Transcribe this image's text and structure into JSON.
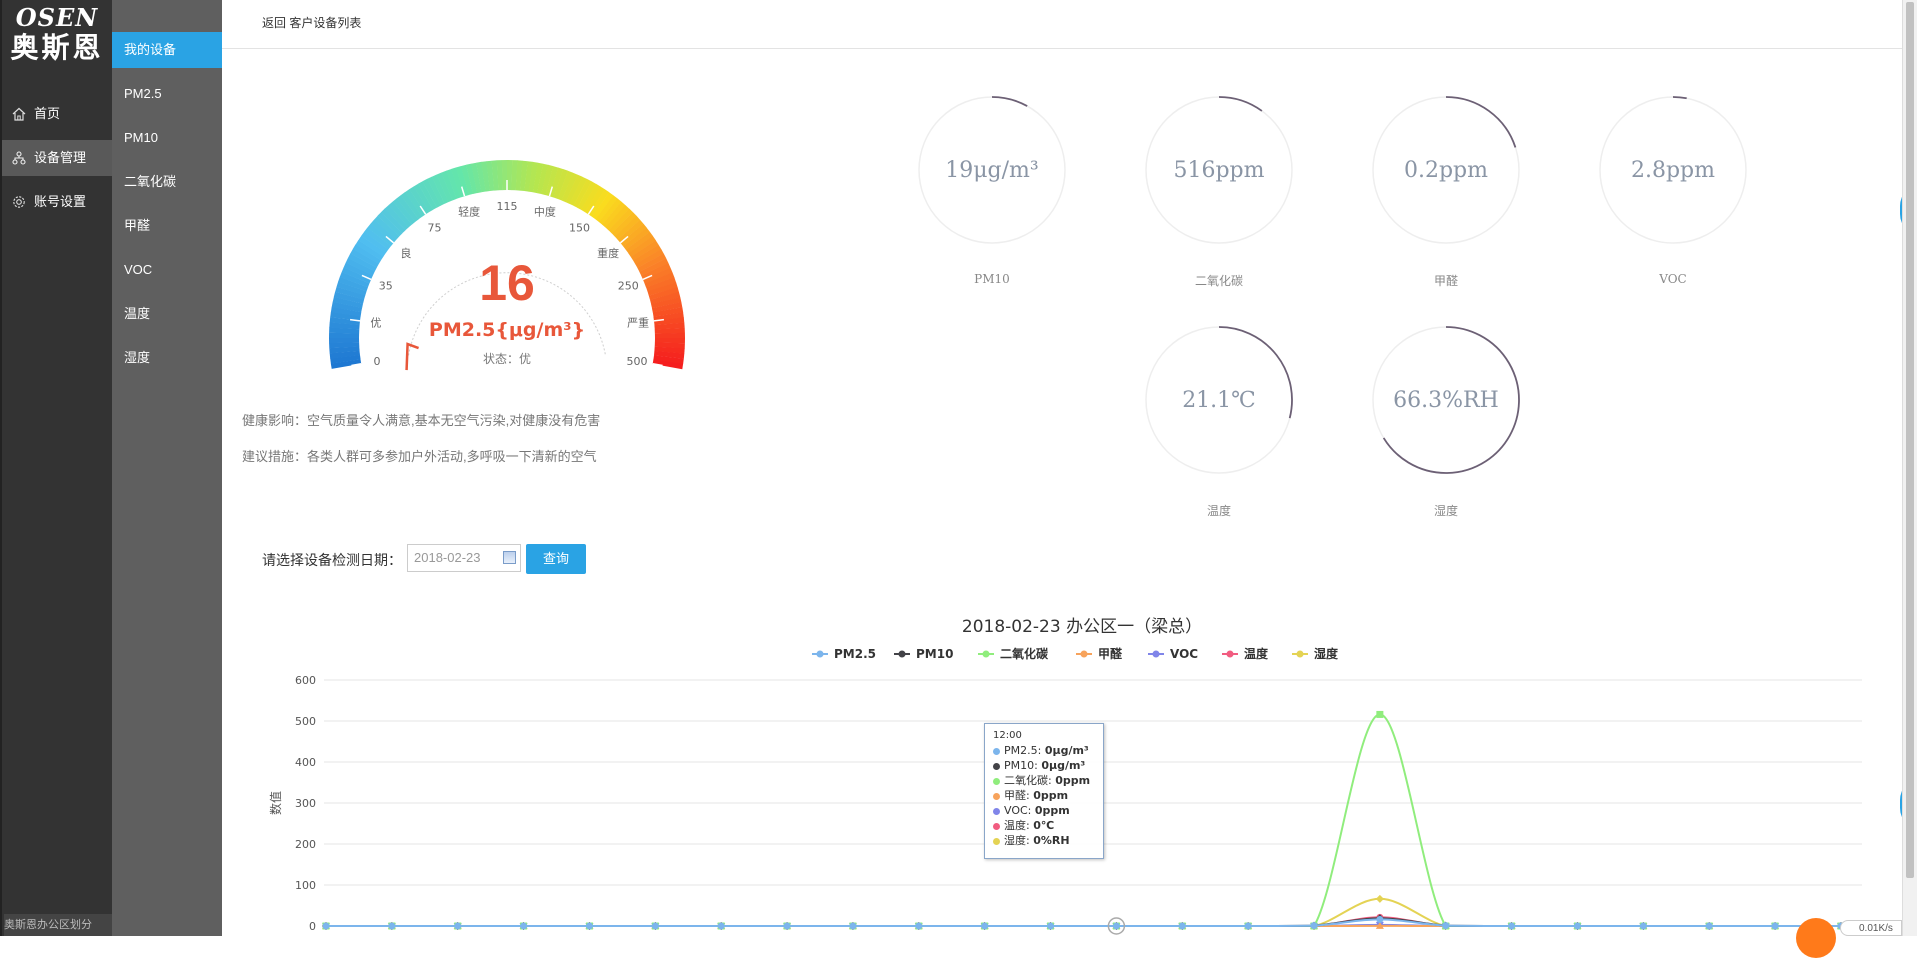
{
  "brand": {
    "en": "OSEN",
    "cn": "奥斯恩"
  },
  "nav": [
    {
      "label": "首页",
      "icon": "home-icon",
      "active": false
    },
    {
      "label": "设备管理",
      "icon": "device-tree-icon",
      "active": true
    },
    {
      "label": "账号设置",
      "icon": "gear-icon",
      "active": false
    }
  ],
  "subnav": [
    "我的设备",
    "PM2.5",
    "PM10",
    "二氧化碳",
    "甲醛",
    "VOC",
    "温度",
    "湿度"
  ],
  "bottom_text": "奥斯恩办公区划分",
  "breadcrumb": {
    "back": "返回",
    "current": "客户设备列表"
  },
  "gauge": {
    "value": "16",
    "unit": "PM2.5{μg/m³}",
    "status": "状态：优",
    "value_num": 16,
    "max": 500,
    "ticks": [
      "0",
      "35",
      "75",
      "115",
      "150",
      "250",
      "500"
    ],
    "levels": [
      "优",
      "良",
      "轻度",
      "中度",
      "重度",
      "严重"
    ],
    "accent_color": "#e8573a"
  },
  "health": {
    "impact": "健康影响：空气质量令人满意,基本无空气污染,对健康没有危害",
    "advice": "建议措施：各类人群可多参加户外活动,多呼吸一下清新的空气"
  },
  "rings": [
    {
      "value": "19μg/m³",
      "label": "PM10",
      "fraction": 0.08
    },
    {
      "value": "516ppm",
      "label": "二氧化碳",
      "fraction": 0.1
    },
    {
      "value": "0.2ppm",
      "label": "甲醛",
      "fraction": 0.2
    },
    {
      "value": "2.8ppm",
      "label": "VOC",
      "fraction": 0.03
    },
    {
      "value": "21.1℃",
      "label": "温度",
      "fraction": 0.29
    },
    {
      "value": "66.3%RH",
      "label": "湿度",
      "fraction": 0.663
    }
  ],
  "date_query": {
    "label": "请选择设备检测日期：",
    "date": "2018-02-23",
    "button": "查询"
  },
  "chart_data": {
    "type": "line",
    "title": "2018-02-23 办公区一（梁总）",
    "ylabel": "数值",
    "ylim": [
      0,
      600
    ],
    "yticks": [
      "0",
      "100",
      "200",
      "300",
      "400",
      "500",
      "600"
    ],
    "grid": true,
    "legend_position": "top-center",
    "x_count": 24,
    "series": [
      {
        "name": "PM2.5",
        "color": "#7cb5ec",
        "marker": "circle",
        "values": [
          0,
          0,
          0,
          0,
          0,
          0,
          0,
          0,
          0,
          0,
          0,
          0,
          0,
          0,
          0,
          1,
          16,
          1,
          0,
          0,
          0,
          0,
          0,
          0
        ]
      },
      {
        "name": "PM10",
        "color": "#434348",
        "marker": "diamond",
        "values": [
          0,
          0,
          0,
          0,
          0,
          0,
          0,
          0,
          0,
          0,
          0,
          0,
          0,
          0,
          0,
          1,
          19,
          1,
          0,
          0,
          0,
          0,
          0,
          0
        ]
      },
      {
        "name": "二氧化碳",
        "color": "#90ed7d",
        "marker": "square",
        "values": [
          0,
          0,
          0,
          0,
          0,
          0,
          0,
          0,
          0,
          0,
          0,
          0,
          0,
          0,
          0,
          0,
          516,
          0,
          0,
          0,
          0,
          0,
          0,
          0
        ]
      },
      {
        "name": "甲醛",
        "color": "#f7a35c",
        "marker": "triangle",
        "values": [
          0,
          0,
          0,
          0,
          0,
          0,
          0,
          0,
          0,
          0,
          0,
          0,
          0,
          0,
          0,
          0,
          0.2,
          0,
          0,
          0,
          0,
          0,
          0,
          0
        ]
      },
      {
        "name": "VOC",
        "color": "#8085e9",
        "marker": "triangle-down",
        "values": [
          0,
          0,
          0,
          0,
          0,
          0,
          0,
          0,
          0,
          0,
          0,
          0,
          0,
          0,
          0,
          0,
          2.8,
          0,
          0,
          0,
          0,
          0,
          0,
          0
        ]
      },
      {
        "name": "温度",
        "color": "#f15c80",
        "marker": "circle",
        "values": [
          0,
          0,
          0,
          0,
          0,
          0,
          0,
          0,
          0,
          0,
          0,
          0,
          0,
          0,
          0,
          0,
          21.1,
          0,
          0,
          0,
          0,
          0,
          0,
          0
        ]
      },
      {
        "name": "湿度",
        "color": "#e4d354",
        "marker": "diamond",
        "values": [
          0,
          0,
          0,
          0,
          0,
          0,
          0,
          0,
          0,
          0,
          0,
          0,
          0,
          0,
          0,
          0,
          66.3,
          0,
          0,
          0,
          0,
          0,
          0,
          0
        ]
      }
    ]
  },
  "tooltip": {
    "time": "12:00",
    "rows": [
      {
        "name": "PM2.5",
        "value": "0μg/m³"
      },
      {
        "name": "PM10",
        "value": "0μg/m³"
      },
      {
        "name": "二氧化碳",
        "value": "0ppm"
      },
      {
        "name": "甲醛",
        "value": "0ppm"
      },
      {
        "name": "VOC",
        "value": "0ppm"
      },
      {
        "name": "温度",
        "value": "0℃"
      },
      {
        "name": "湿度",
        "value": "0%RH"
      }
    ]
  },
  "speed": "0.01K/s"
}
